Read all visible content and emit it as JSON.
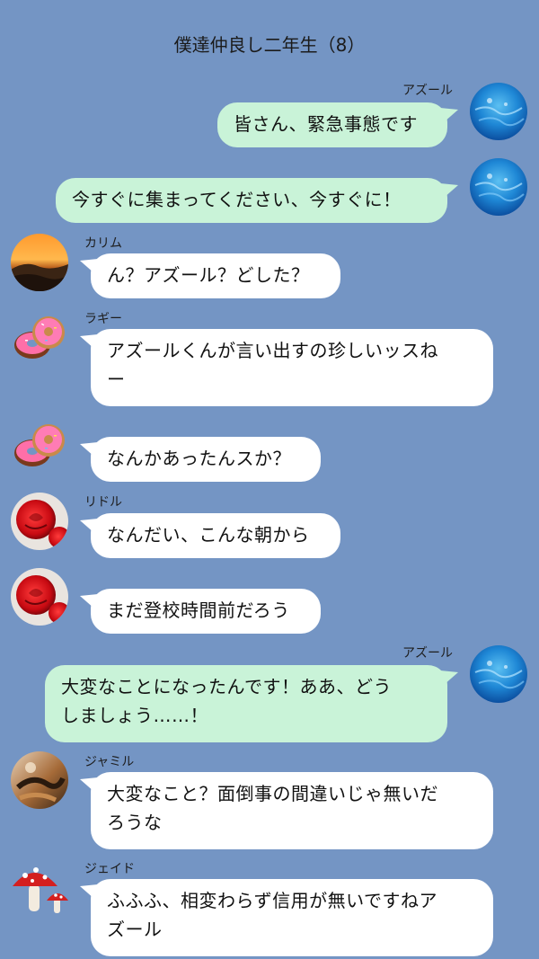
{
  "header": {
    "title": "僕達仲良し二年生（8）"
  },
  "messages": [
    {
      "sender": "アズール",
      "text": "皆さん、緊急事態です",
      "avatar_icon": "water-avatar-icon"
    },
    {
      "sender": "",
      "text": "今すぐに集まってください、今すぐに！",
      "avatar_icon": "water-avatar-icon"
    },
    {
      "sender": "カリム",
      "text": "ん？アズール？どした？",
      "avatar_icon": "sunset-avatar-icon"
    },
    {
      "sender": "ラギー",
      "text": "アズールくんが言い出すの珍しいッスね\nー",
      "avatar_icon": "donut-avatar-icon"
    },
    {
      "sender": "",
      "text": "なんかあったんスか？",
      "avatar_icon": "donut-avatar-icon"
    },
    {
      "sender": "リドル",
      "text": "なんだい、こんな朝から",
      "avatar_icon": "rose-avatar-icon"
    },
    {
      "sender": "",
      "text": "まだ登校時間前だろう",
      "avatar_icon": "rose-avatar-icon"
    },
    {
      "sender": "アズール",
      "text": "大変なことになったんです！ああ、どう\nしましょう……！",
      "avatar_icon": "water-avatar-icon"
    },
    {
      "sender": "ジャミル",
      "text": "大変なこと？面倒事の間違いじゃ無いだ\nろうな",
      "avatar_icon": "snake-avatar-icon"
    },
    {
      "sender": "ジェイド",
      "text": "ふふふ、相変わらず信用が無いですねア\nズール",
      "avatar_icon": "mushroom-avatar-icon"
    }
  ],
  "colors": {
    "background": "#7495c4",
    "outgoing_bubble": "#c9f3d8",
    "incoming_bubble": "#ffffff"
  }
}
